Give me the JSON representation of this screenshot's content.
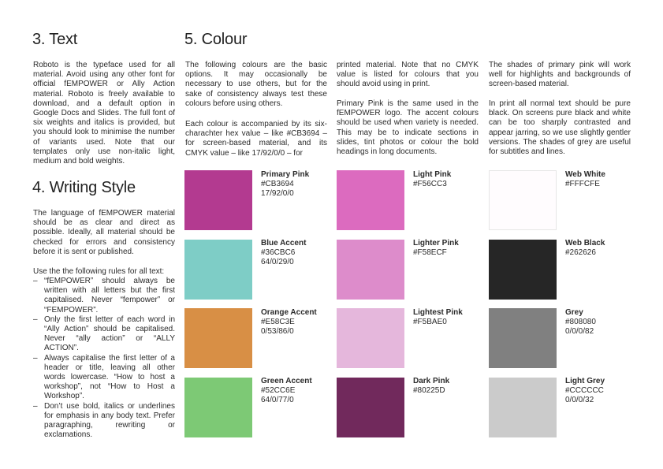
{
  "sections": {
    "text": {
      "heading": "3. Text",
      "body": "Roboto is the typeface used for all material. Avoid using any other font for official fEMPOWER or Ally Action material. Roboto is freely available to download, and a default option in Google Docs and Slides. The full font of six weights and italics is provided, but you should look to minimise the number of variants used. Note that our templates only use non-italic light, medium and bold weights."
    },
    "writing": {
      "heading": "4. Writing Style",
      "intro": "The language of fEMPOWER material should be as clear and direct as possible. Ideally, all material should be checked for errors and consistency before it is sent or published.",
      "rules_intro": "Use the the following rules for all text:",
      "rules": [
        "“fEMPOWER” should always be written with all letters but the first capitalised. Never “fempower” or “FEMPOWER”.",
        "Only the first letter of each word in “Ally Action” should be capitalised. Never “ally action” or “ALLY ACTION”.",
        "Always capitalise the first letter of a header or title, leaving all other words lowercase. “How to host a workshop”, not “How to Host a Workshop”.",
        "Don’t use bold, italics or underlines for emphasis in any body text. Prefer paragraphing, rewriting or exclamations."
      ]
    },
    "colour": {
      "heading": "5. Colour",
      "col1_p1": "The following colours are the basic options. It may occasionally be necessary to use others, but for the sake of consistency always test these colours before using others.",
      "col1_p2": "Each colour is accompanied by its six-charachter hex value – like #CB3694 – for screen-based material, and its CMYK value – like 17/92/0/0 – for",
      "col2_p1": "printed material. Note that no CMYK value is listed for colours that you should avoid using in print.",
      "col2_p2": "Primary Pink is the same used in the fEMPOWER logo. The accent colours should be used when variety is needed. This may be to indicate sections in slides, tint photos or colour the bold headings in long documents.",
      "col3_p1": "The shades of primary pink will work well for highlights and backgrounds of screen-based material.",
      "col3_p2": "In print all normal text should be pure black. On screens pure black and white can be too sharply contrasted and appear jarring, so we use slightly gentler versions. The shades of grey are useful for subtitles and lines."
    }
  },
  "swatches": [
    {
      "name": "Primary Pink",
      "hex": "#CB3694",
      "cmyk": "17/92/0/0",
      "color": "#b33a90"
    },
    {
      "name": "Blue Accent",
      "hex": "#36CBC6",
      "cmyk": "64/0/29/0",
      "color": "#7ecdc6"
    },
    {
      "name": "Orange Accent",
      "hex": "#E58C3E",
      "cmyk": "0/53/86/0",
      "color": "#d88f45"
    },
    {
      "name": "Green Accent",
      "hex": "#52CC6E",
      "cmyk": "64/0/77/0",
      "color": "#7dc975"
    },
    {
      "name": "Light Pink",
      "hex": "#F56CC3",
      "cmyk": "",
      "color": "#dc6bbf"
    },
    {
      "name": "Lighter Pink",
      "hex": "#F58ECF",
      "cmyk": "",
      "color": "#dd8ccb"
    },
    {
      "name": "Lightest Pink",
      "hex": "#F5BAE0",
      "cmyk": "",
      "color": "#e5b7dc"
    },
    {
      "name": "Dark Pink",
      "hex": "#80225D",
      "cmyk": "",
      "color": "#71295c"
    },
    {
      "name": "Web White",
      "hex": "#FFFCFE",
      "cmyk": "",
      "color": "#fffcfe"
    },
    {
      "name": "Web Black",
      "hex": "#262626",
      "cmyk": "",
      "color": "#262626"
    },
    {
      "name": "Grey",
      "hex": "#808080",
      "cmyk": "0/0/0/82",
      "color": "#808080"
    },
    {
      "name": "Light Grey",
      "hex": "#CCCCCC",
      "cmyk": "0/0/0/32",
      "color": "#cbcbcb"
    }
  ]
}
